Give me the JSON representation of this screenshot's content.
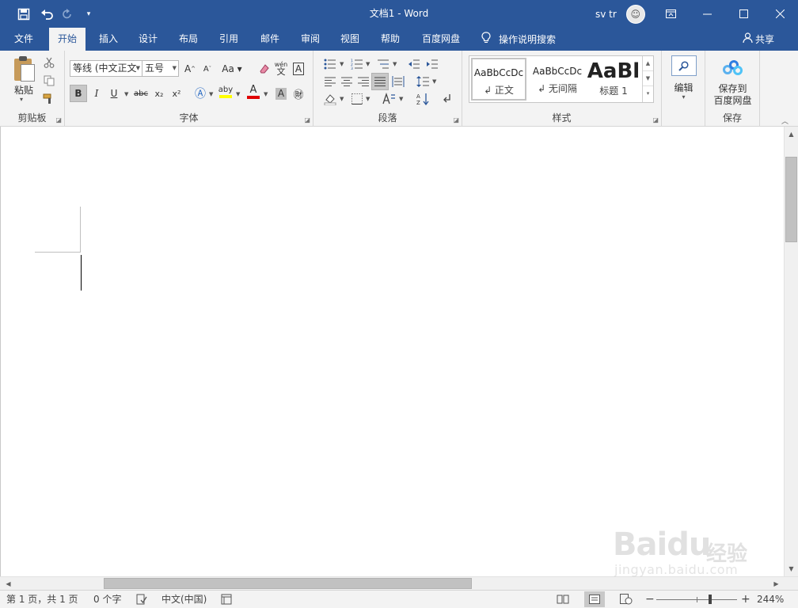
{
  "app": {
    "title": "文档1  -  Word",
    "user_name": "sv tr"
  },
  "qat": {
    "save_icon": "save-icon",
    "undo_icon": "undo-icon",
    "redo_icon": "redo-icon",
    "customize_icon": "customize-qat-icon"
  },
  "tabs": [
    {
      "label": "文件"
    },
    {
      "label": "开始"
    },
    {
      "label": "插入"
    },
    {
      "label": "设计"
    },
    {
      "label": "布局"
    },
    {
      "label": "引用"
    },
    {
      "label": "邮件"
    },
    {
      "label": "审阅"
    },
    {
      "label": "视图"
    },
    {
      "label": "帮助"
    },
    {
      "label": "百度网盘"
    }
  ],
  "tell_me": "操作说明搜索",
  "share": "共享",
  "ribbon": {
    "clipboard": {
      "label": "剪贴板",
      "paste": "粘贴"
    },
    "font": {
      "label": "字体",
      "font_name": "等线 (中文正文",
      "font_size": "五号",
      "bold": "B",
      "italic": "I",
      "underline": "U",
      "strike": "abc",
      "subscript": "x₂",
      "superscript": "x²",
      "phonetic": "wén"
    },
    "paragraph": {
      "label": "段落"
    },
    "styles": {
      "label": "样式",
      "items": [
        {
          "sample": "AaBbCcDc",
          "name": "↲ 正文"
        },
        {
          "sample": "AaBbCcDc",
          "name": "↲ 无间隔"
        },
        {
          "sample": "AaBl",
          "name": "标题 1"
        }
      ]
    },
    "editing": {
      "label": "编辑"
    },
    "save": {
      "button_line1": "保存到",
      "button_line2": "百度网盘",
      "label": "保存"
    }
  },
  "status": {
    "page": "第 1 页，共 1 页",
    "words": "0 个字",
    "language": "中文(中国)",
    "zoom": "244%",
    "zoom_minus": "−",
    "zoom_plus": "+"
  },
  "watermark": {
    "logo": "Baidu",
    "cn": "经验",
    "url": "jingyan.baidu.com"
  },
  "colors": {
    "title_bar": "#2b579a",
    "ribbon_bg": "#f3f3f3",
    "highlight_yellow": "#ffff00",
    "font_red": "#e00000"
  }
}
